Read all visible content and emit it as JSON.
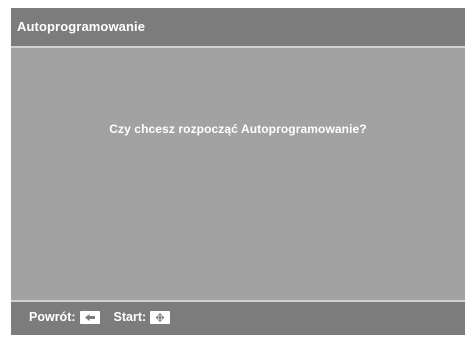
{
  "window": {
    "title": "Autoprogramowanie"
  },
  "dialog": {
    "message": "Czy chcesz rozpocząć Autoprogramowanie?"
  },
  "footer": {
    "back_label": "Powrót:",
    "back_icon": "return-key-icon",
    "start_label": "Start:",
    "start_icon": "enter-key-icon"
  },
  "colors": {
    "background": "#a2a2a2",
    "bar": "#7c7c7c",
    "text": "#ffffff"
  }
}
